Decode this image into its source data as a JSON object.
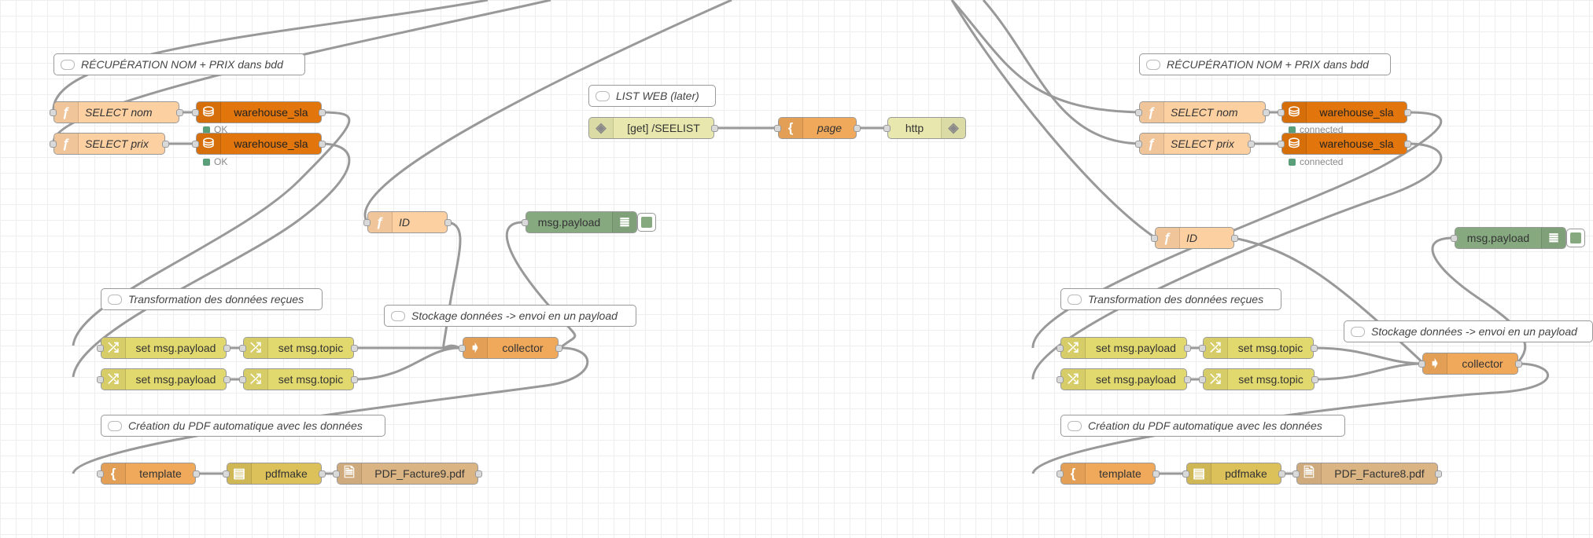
{
  "flows": [
    {
      "comment_recuperation": "RÉCUPÉRATION NOM + PRIX dans bdd",
      "select_nom": "SELECT nom",
      "select_prix": "SELECT prix",
      "db_1": "warehouse_sla",
      "db_2": "warehouse_sla",
      "db_1_status": "OK",
      "db_2_status": "OK",
      "id": "ID",
      "debug": "msg.payload",
      "comment_transformation": "Transformation des données reçues",
      "set_payload_1": "set msg.payload",
      "set_topic_1": "set msg.topic",
      "set_payload_2": "set msg.payload",
      "set_topic_2": "set msg.topic",
      "comment_stockage": "Stockage données -> envoi en un payload",
      "collector": "collector",
      "comment_creation": "Création du PDF automatique avec les données",
      "template": "template",
      "pdfmake": "pdfmake",
      "file": "PDF_Facture9.pdf"
    },
    {
      "comment_recuperation": "RÉCUPÉRATION NOM + PRIX dans bdd",
      "select_nom": "SELECT nom",
      "select_prix": "SELECT prix",
      "db_1": "warehouse_sla",
      "db_2": "warehouse_sla",
      "db_1_status": "connected",
      "db_2_status": "connected",
      "id": "ID",
      "debug": "msg.payload",
      "comment_transformation": "Transformation des données reçues",
      "set_payload_1": "set msg.payload",
      "set_topic_1": "set msg.topic",
      "set_payload_2": "set msg.payload",
      "set_topic_2": "set msg.topic",
      "comment_stockage": "Stockage données -> envoi en un payload",
      "collector": "collector",
      "comment_creation": "Création du PDF automatique avec les données",
      "template": "template",
      "pdfmake": "pdfmake",
      "file": "PDF_Facture8.pdf"
    }
  ],
  "listweb": {
    "comment": "LIST WEB (later)",
    "http_in": "[get] /SEELIST",
    "page": "page",
    "http_out": "http"
  },
  "colors": {
    "function": "#fdd0a2",
    "database": "#e2750b",
    "change": "#e2d96e",
    "template": "#f0a85a",
    "debug": "#87a980",
    "http": "#e7e7ae",
    "pdfmake": "#dcc15a",
    "file": "#dbb483",
    "status_ok": "#5a9e7a"
  },
  "icons": {
    "function": "function-icon",
    "database": "database-icon",
    "change": "shuffle-icon",
    "template": "braces-icon",
    "debug": "list-icon",
    "http": "globe-icon",
    "pdfmake": "pdf-icon",
    "file": "file-icon",
    "collector": "arrow-right-icon",
    "comment": "comment-icon"
  }
}
